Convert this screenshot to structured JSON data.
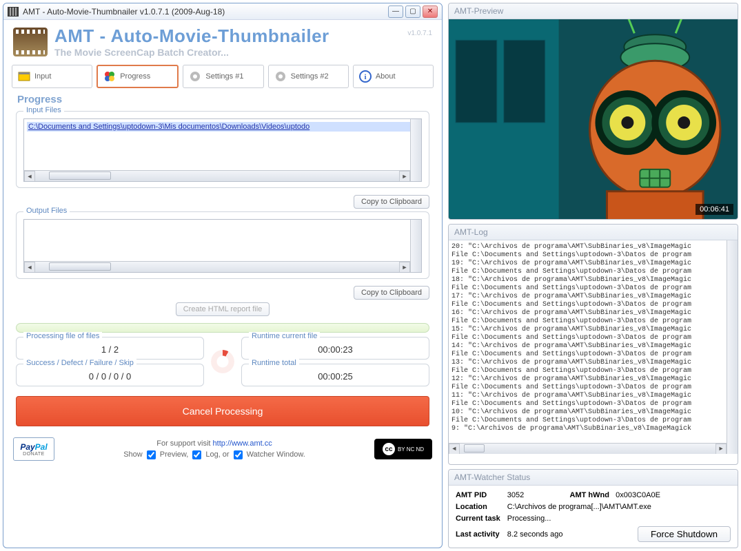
{
  "window": {
    "title": "AMT - Auto-Movie-Thumbnailer v1.0.7.1 (2009-Aug-18)"
  },
  "banner": {
    "title": "AMT - Auto-Movie-Thumbnailer",
    "subtitle": "The Movie ScreenCap Batch Creator...",
    "version": "v1.0.7.1"
  },
  "tabs": {
    "input": "Input",
    "progress": "Progress",
    "settings1": "Settings #1",
    "settings2": "Settings #2",
    "about": "About"
  },
  "section_title": "Progress",
  "input_files": {
    "legend": "Input Files",
    "item0": "C:\\Documents and Settings\\uptodown-3\\Mis documentos\\Downloads\\Videos\\uptodo",
    "copy_btn": "Copy to Clipboard"
  },
  "output_files": {
    "legend": "Output Files",
    "copy_btn": "Copy to Clipboard"
  },
  "create_report_btn": "Create HTML report file",
  "stats": {
    "proc_legend": "Processing file of files",
    "proc_val": "1 / 2",
    "sdf_legend": "Success / Defect / Failure / Skip",
    "sdf_val": "0 / 0 / 0 / 0",
    "rt_cur_legend": "Runtime current file",
    "rt_cur_val": "00:00:23",
    "rt_tot_legend": "Runtime total",
    "rt_tot_val": "00:00:25"
  },
  "cancel_btn": "Cancel Processing",
  "footer": {
    "support_prefix": "For support visit ",
    "support_url": "http://www.amt.cc",
    "show_label": "Show",
    "preview_label": "Preview,",
    "log_label": "Log, or",
    "watcher_label": "Watcher Window.",
    "donate": "DONATE",
    "cc_text": "BY NC ND"
  },
  "preview": {
    "title": "AMT-Preview",
    "timestamp": "00:06:41"
  },
  "log": {
    "title": "AMT-Log",
    "lines": [
      "20: \"C:\\Archivos de programa\\AMT\\SubBinaries_v8\\ImageMagic",
      "File C:\\Documents and Settings\\uptodown-3\\Datos de program",
      "19: \"C:\\Archivos de programa\\AMT\\SubBinaries_v8\\ImageMagic",
      "File C:\\Documents and Settings\\uptodown-3\\Datos de program",
      "18: \"C:\\Archivos de programa\\AMT\\SubBinaries_v8\\ImageMagic",
      "File C:\\Documents and Settings\\uptodown-3\\Datos de program",
      "17: \"C:\\Archivos de programa\\AMT\\SubBinaries_v8\\ImageMagic",
      "File C:\\Documents and Settings\\uptodown-3\\Datos de program",
      "16: \"C:\\Archivos de programa\\AMT\\SubBinaries_v8\\ImageMagic",
      "File C:\\Documents and Settings\\uptodown-3\\Datos de program",
      "15: \"C:\\Archivos de programa\\AMT\\SubBinaries_v8\\ImageMagic",
      "File C:\\Documents and Settings\\uptodown-3\\Datos de program",
      "14: \"C:\\Archivos de programa\\AMT\\SubBinaries_v8\\ImageMagic",
      "File C:\\Documents and Settings\\uptodown-3\\Datos de program",
      "13: \"C:\\Archivos de programa\\AMT\\SubBinaries_v8\\ImageMagic",
      "File C:\\Documents and Settings\\uptodown-3\\Datos de program",
      "12: \"C:\\Archivos de programa\\AMT\\SubBinaries_v8\\ImageMagic",
      "File C:\\Documents and Settings\\uptodown-3\\Datos de program",
      "11: \"C:\\Archivos de programa\\AMT\\SubBinaries_v8\\ImageMagic",
      "File C:\\Documents and Settings\\uptodown-3\\Datos de program",
      "10: \"C:\\Archivos de programa\\AMT\\SubBinaries_v8\\ImageMagic",
      "File C:\\Documents and Settings\\uptodown-3\\Datos de program",
      "9: \"C:\\Archivos de programa\\AMT\\SubBinaries_v8\\ImageMagick"
    ]
  },
  "watcher": {
    "title": "AMT-Watcher Status",
    "pid_label": "AMT PID",
    "pid_val": "3052",
    "hwnd_label": "AMT hWnd",
    "hwnd_val": "0x003C0A0E",
    "loc_label": "Location",
    "loc_val": "C:\\Archivos de programa[...]\\AMT\\AMT.exe",
    "task_label": "Current task",
    "task_val": "Processing...",
    "act_label": "Last activity",
    "act_val": "8.2 seconds ago",
    "force_btn": "Force Shutdown"
  }
}
